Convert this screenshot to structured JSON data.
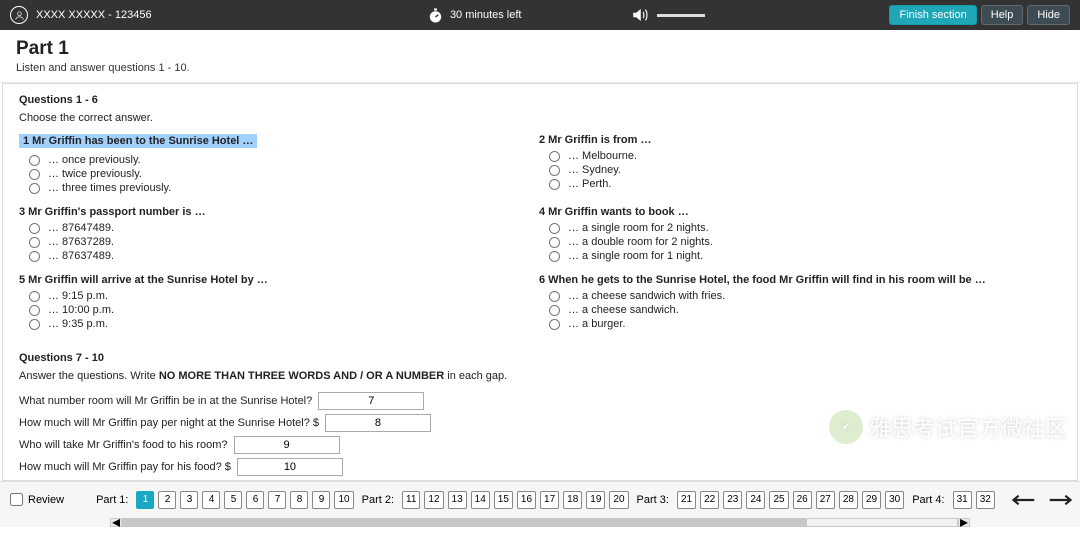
{
  "top": {
    "user": "XXXX XXXXX - 123456",
    "timer": "30 minutes left",
    "finish": "Finish section",
    "help": "Help",
    "hide": "Hide"
  },
  "part": {
    "title": "Part 1",
    "sub": "Listen and answer questions 1 - 10."
  },
  "sec_a": {
    "title": "Questions 1 - 6",
    "instr": "Choose the correct answer."
  },
  "q1": {
    "t": "1  Mr Griffin has been to the Sunrise Hotel …",
    "a": "… once previously.",
    "b": "… twice previously.",
    "c": "… three times previously."
  },
  "q2": {
    "t": "2  Mr Griffin is from …",
    "a": "… Melbourne.",
    "b": "… Sydney.",
    "c": "… Perth."
  },
  "q3": {
    "t": "3  Mr Griffin's passport number is …",
    "a": "… 87647489.",
    "b": "… 87637289.",
    "c": "… 87637489."
  },
  "q4": {
    "t": "4  Mr Griffin wants to book …",
    "a": "… a single room for 2 nights.",
    "b": "… a double room for 2 nights.",
    "c": "… a single room for 1 night."
  },
  "q5": {
    "t": "5  Mr Griffin will arrive at the Sunrise Hotel by …",
    "a": "… 9:15 p.m.",
    "b": "… 10:00 p.m.",
    "c": "… 9:35 p.m."
  },
  "q6": {
    "t": "6  When he gets to the Sunrise Hotel, the food Mr Griffin will find in his room will be …",
    "a": "… a cheese sandwich with fries.",
    "b": "… a cheese sandwich.",
    "c": "… a burger."
  },
  "sec_b": {
    "title": "Questions 7 - 10",
    "instr_a": "Answer the questions. Write ",
    "instr_b": "NO MORE THAN THREE WORDS AND / OR A NUMBER",
    "instr_c": " in each gap."
  },
  "q7": {
    "l": "What number room will Mr Griffin be in at the Sunrise Hotel?",
    "v": "7"
  },
  "q8": {
    "l": "How much will Mr Griffin pay per night at the Sunrise Hotel? $",
    "v": "8"
  },
  "q9": {
    "l": "Who will take Mr Griffin's food to his room?",
    "v": "9"
  },
  "q10": {
    "l": "How much will Mr Griffin pay for his food? $",
    "v": "10"
  },
  "bottom": {
    "review": "Review",
    "parts": [
      "Part 1:",
      "Part 2:",
      "Part 3:",
      "Part 4:"
    ],
    "nums": {
      "p1": [
        "1",
        "2",
        "3",
        "4",
        "5",
        "6",
        "7",
        "8",
        "9",
        "10"
      ],
      "p2": [
        "11",
        "12",
        "13",
        "14",
        "15",
        "16",
        "17",
        "18",
        "19",
        "20"
      ],
      "p3": [
        "21",
        "22",
        "23",
        "24",
        "25",
        "26",
        "27",
        "28",
        "29",
        "30"
      ],
      "p4": [
        "31",
        "32"
      ]
    }
  },
  "watermark": "雅思考试官方微社区"
}
